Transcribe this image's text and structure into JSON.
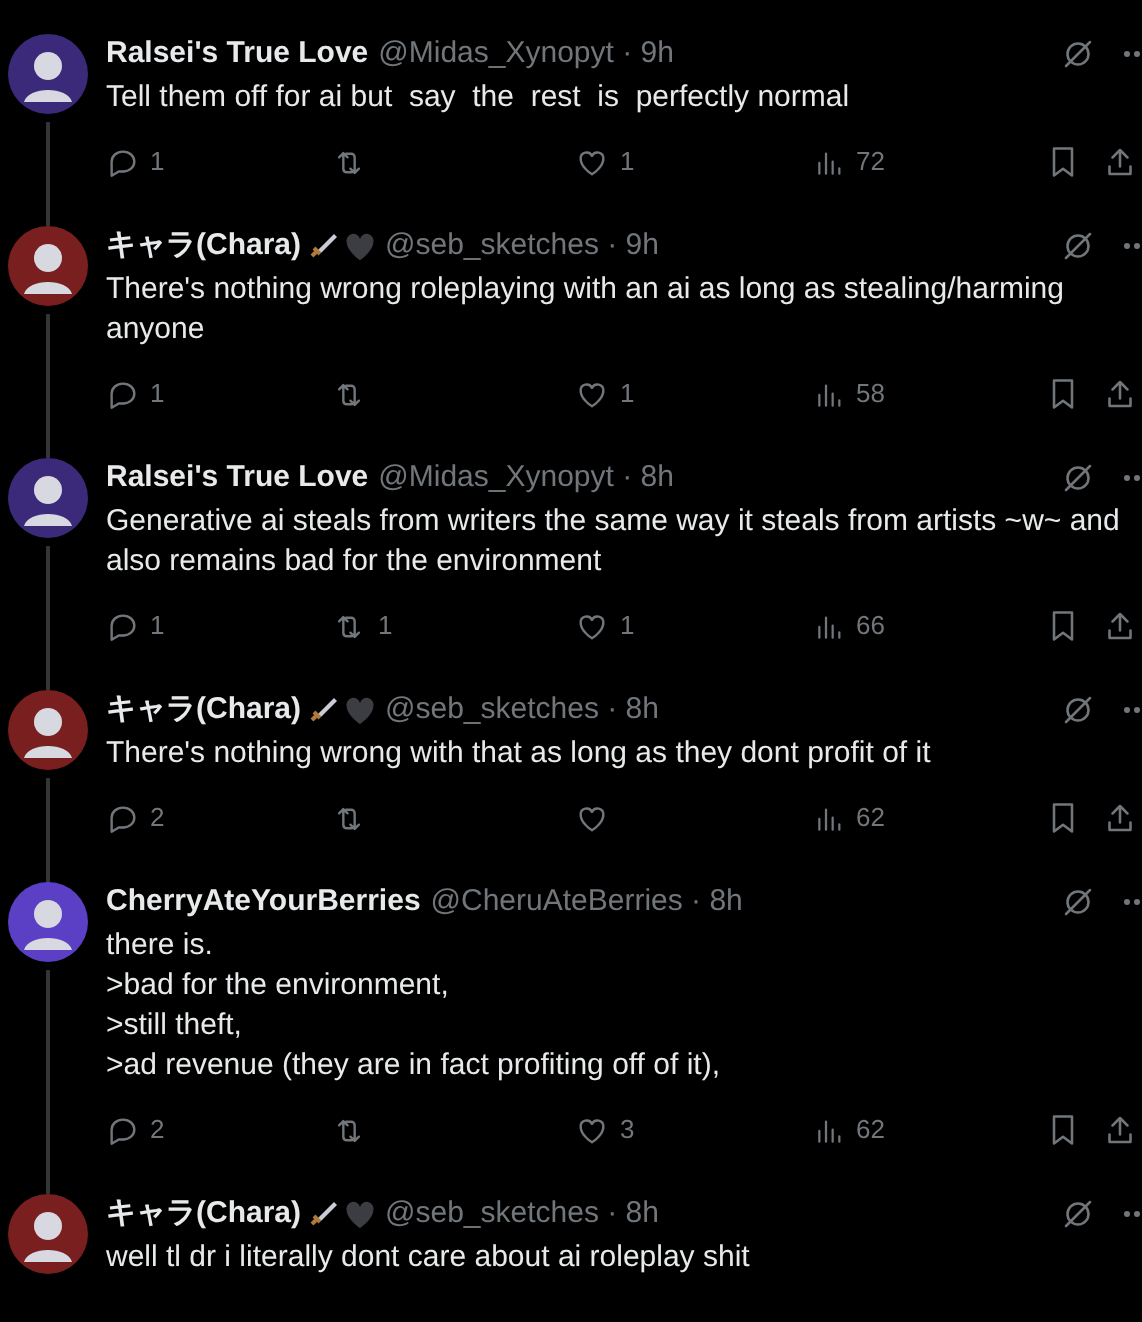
{
  "tweets": [
    {
      "name": "Ralsei's True Love",
      "meta": "@Midas_Xynopyt · 9h",
      "kind": "plain",
      "text": [
        "Tell them off for ai but  say  the  rest  is  perfectly normal"
      ],
      "replies": "1",
      "likes": "1",
      "views": "72"
    },
    {
      "name": "キャラ(Chara)",
      "meta": "@seb_sketches · 9h",
      "kind": "emoji",
      "text": [
        "There's nothing wrong roleplaying with an ai as long as stealing/harming anyone"
      ],
      "replies": "1",
      "likes": "1",
      "views": "58"
    },
    {
      "name": "Ralsei's True Love",
      "meta": "@Midas_Xynopyt · 8h",
      "kind": "plain",
      "text": [
        "Generative ai steals from writers the same way it steals from artists ~w~ and also remains bad for the environment"
      ],
      "replies": "1",
      "reposts": "1",
      "likes": "1",
      "views": "66"
    },
    {
      "name": "キャラ(Chara)",
      "meta": "@seb_sketches · 8h",
      "kind": "emoji",
      "text": [
        "There's nothing wrong with that as long as they dont profit of it"
      ],
      "replies": "2",
      "views": "62"
    },
    {
      "name": "CherryAteYourBerries",
      "meta": "@CheruAteBerries · 8h",
      "kind": "plain",
      "text": [
        "there is.",
        ">bad for the environment,",
        ">still theft,",
        ">ad revenue (they are in fact profiting off of it),"
      ],
      "replies": "2",
      "likes": "3",
      "views": "62"
    },
    {
      "name": "キャラ(Chara)",
      "meta": "@seb_sketches · 8h",
      "kind": "emoji",
      "text": [
        "well tl dr i literally dont care about ai roleplay shit"
      ]
    }
  ]
}
